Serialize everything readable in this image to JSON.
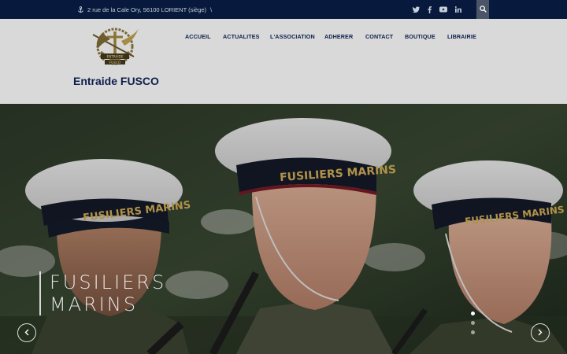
{
  "topbar": {
    "address": "2 rue de la Cale Ory, 56100 LORIENT (siège)",
    "separator": "\\",
    "social": [
      "twitter-icon",
      "facebook-icon",
      "youtube-icon",
      "linkedin-icon"
    ],
    "search_icon": "search-icon"
  },
  "header": {
    "logo_text_top": "ENTRAIDE",
    "logo_text_bottom": "FUSCO",
    "site_title": "Entraide FUSCO",
    "nav": [
      "ACCUEIL",
      "ACTUALITES",
      "L'ASSOCIATION",
      "ADHERER",
      "CONTACT",
      "BOUTIQUE",
      "LIBRAIRIE"
    ]
  },
  "hero": {
    "cap_band_text": "FUSILIERS MARINS",
    "caption_line1": "FUSILIERS",
    "caption_line2": "MARINS",
    "prev_icon": "chevron-left-icon",
    "next_icon": "chevron-right-icon",
    "slide_count": 3,
    "active_slide": 1
  },
  "colors": {
    "topbar_bg": "#071a3d",
    "header_bg": "#d9d9d9",
    "nav_text": "#0d1f4d",
    "search_bg": "#4b5568"
  }
}
